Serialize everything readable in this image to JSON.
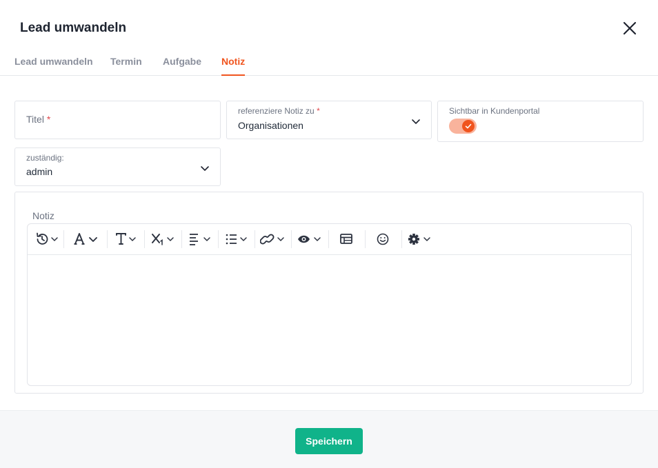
{
  "dialog": {
    "title": "Lead umwandeln"
  },
  "tabs": [
    {
      "label": "Lead umwandeln"
    },
    {
      "label": "Termin"
    },
    {
      "label": "Aufgabe"
    },
    {
      "label": "Notiz"
    }
  ],
  "active_tab": "Notiz",
  "form": {
    "title_field": {
      "placeholder": "Titel",
      "required_mark": "*"
    },
    "reference": {
      "label": "referenziere Notiz zu",
      "required_mark": "*",
      "value": "Organisationen"
    },
    "portal": {
      "label": "Sichtbar in Kundenportal",
      "checked": true
    },
    "assignee": {
      "label": "zuständig:",
      "value": "admin"
    },
    "note": {
      "label": "Notiz"
    }
  },
  "toolbar": {
    "icons": [
      "history-icon",
      "font-color-icon",
      "text-style-icon",
      "subscript-icon",
      "align-icon",
      "list-icon",
      "link-icon",
      "preview-icon",
      "table-icon",
      "emoji-icon",
      "settings-icon"
    ]
  },
  "footer": {
    "save_label": "Speichern"
  },
  "colors": {
    "accent": "#f0541e",
    "primary_button": "#10b38a",
    "toggle_track": "#f9b39c"
  }
}
